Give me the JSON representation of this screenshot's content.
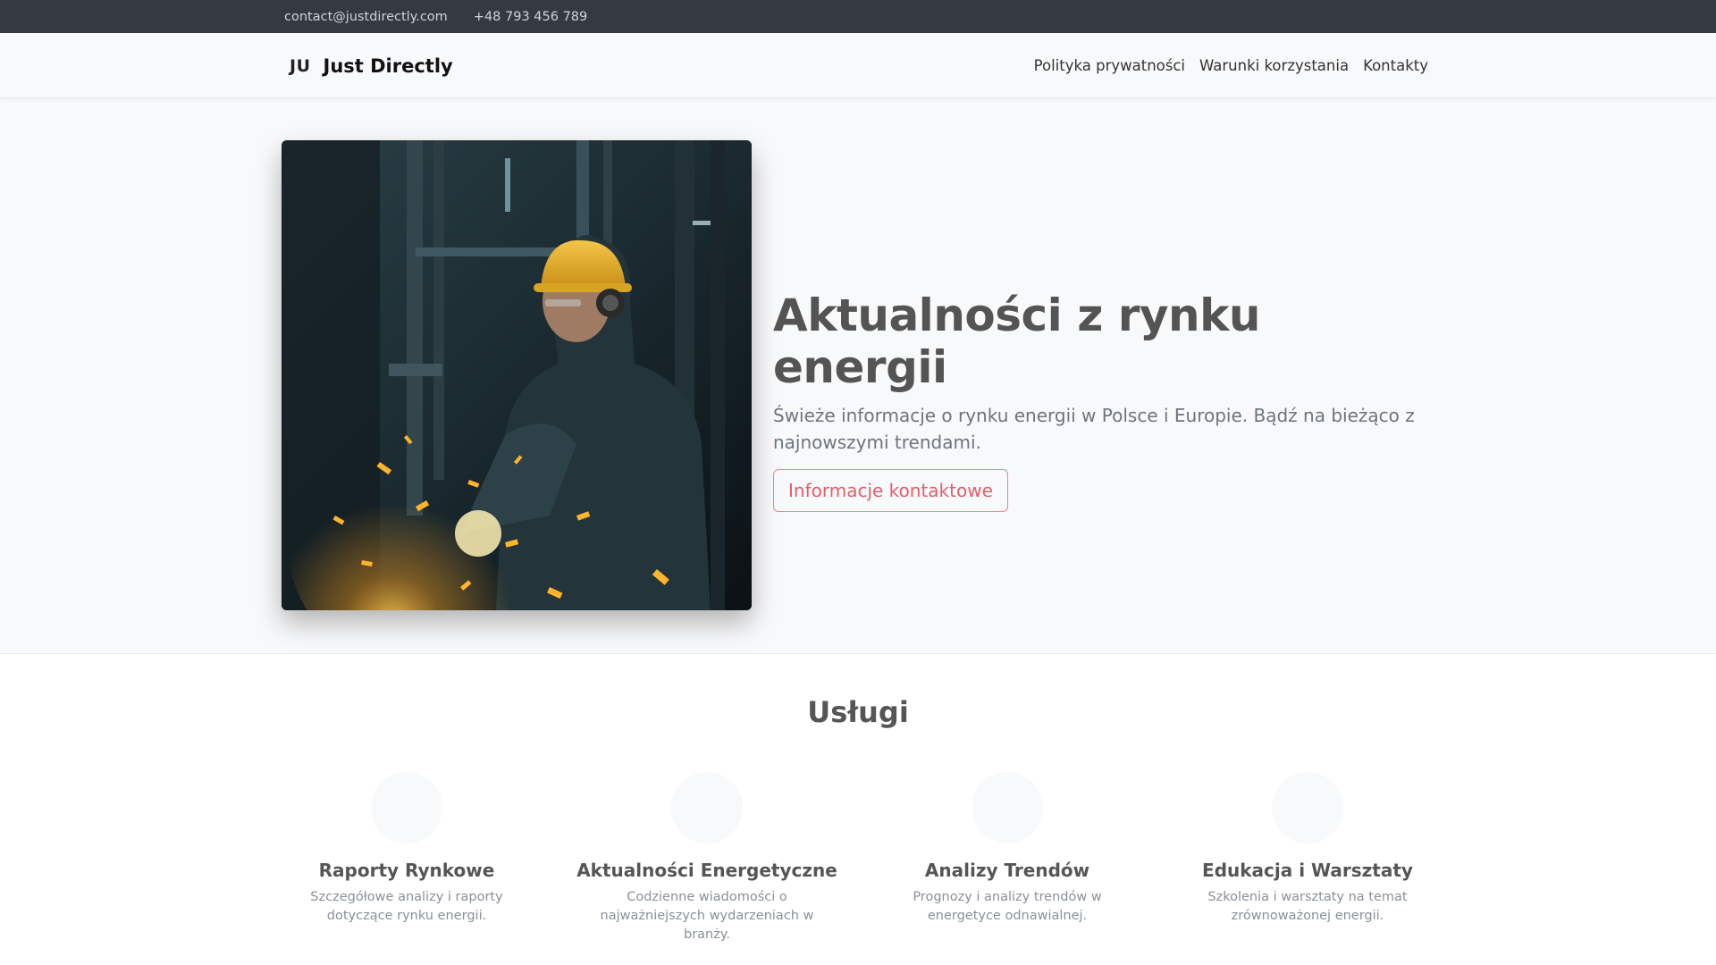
{
  "topbar": {
    "email": "contact@justdirectly.com",
    "phone": "+48 793 456 789"
  },
  "navbar": {
    "logo_mark": "JU",
    "brand_name": "Just Directly",
    "links": [
      {
        "label": "Polityka prywatności"
      },
      {
        "label": "Warunki korzystania"
      },
      {
        "label": "Kontakty"
      }
    ]
  },
  "hero": {
    "title": "Aktualności z rynku energii",
    "subtitle": "Świeże informacje o rynku energii w Polsce i Europie. Bądź na bieżąco z najnowszymi trendami.",
    "button_label": "Informacje kontaktowe"
  },
  "services": {
    "title": "Usługi",
    "items": [
      {
        "title": "Raporty Rynkowe",
        "description": "Szczegółowe analizy i raporty dotyczące rynku energii."
      },
      {
        "title": "Aktualności Energetyczne",
        "description": "Codzienne wiadomości o najważniejszych wydarzeniach w branży."
      },
      {
        "title": "Analizy Trendów",
        "description": "Prognozy i analizy trendów w energetyce odnawialnej."
      },
      {
        "title": "Edukacja i Warsztaty",
        "description": "Szkolenia i warsztaty na temat zrównoważonej energii."
      }
    ]
  }
}
